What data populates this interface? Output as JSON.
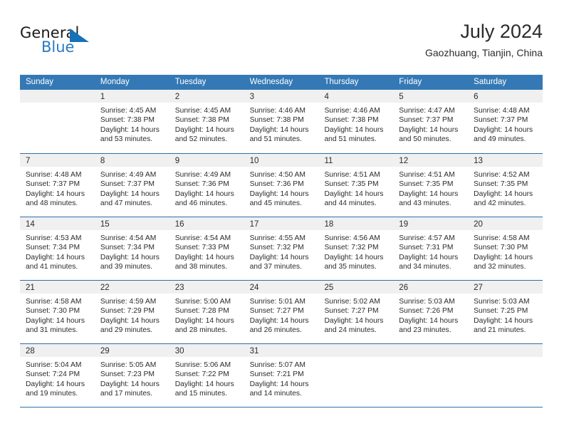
{
  "brand": {
    "word_one": "General",
    "word_two": "Blue",
    "logo_icon": "triangle-logo-icon",
    "accent_color": "#1572b8"
  },
  "header": {
    "title": "July 2024",
    "subtitle": "Gaozhuang, Tianjin, China"
  },
  "calendar": {
    "header_color": "#3479b5",
    "weekdays": [
      "Sunday",
      "Monday",
      "Tuesday",
      "Wednesday",
      "Thursday",
      "Friday",
      "Saturday"
    ],
    "weeks": [
      [
        {
          "day": "",
          "empty": true,
          "lines": []
        },
        {
          "day": "1",
          "lines": [
            "Sunrise: 4:45 AM",
            "Sunset: 7:38 PM",
            "Daylight: 14 hours",
            "and 53 minutes."
          ]
        },
        {
          "day": "2",
          "lines": [
            "Sunrise: 4:45 AM",
            "Sunset: 7:38 PM",
            "Daylight: 14 hours",
            "and 52 minutes."
          ]
        },
        {
          "day": "3",
          "lines": [
            "Sunrise: 4:46 AM",
            "Sunset: 7:38 PM",
            "Daylight: 14 hours",
            "and 51 minutes."
          ]
        },
        {
          "day": "4",
          "lines": [
            "Sunrise: 4:46 AM",
            "Sunset: 7:38 PM",
            "Daylight: 14 hours",
            "and 51 minutes."
          ]
        },
        {
          "day": "5",
          "lines": [
            "Sunrise: 4:47 AM",
            "Sunset: 7:37 PM",
            "Daylight: 14 hours",
            "and 50 minutes."
          ]
        },
        {
          "day": "6",
          "lines": [
            "Sunrise: 4:48 AM",
            "Sunset: 7:37 PM",
            "Daylight: 14 hours",
            "and 49 minutes."
          ]
        }
      ],
      [
        {
          "day": "7",
          "lines": [
            "Sunrise: 4:48 AM",
            "Sunset: 7:37 PM",
            "Daylight: 14 hours",
            "and 48 minutes."
          ]
        },
        {
          "day": "8",
          "lines": [
            "Sunrise: 4:49 AM",
            "Sunset: 7:37 PM",
            "Daylight: 14 hours",
            "and 47 minutes."
          ]
        },
        {
          "day": "9",
          "lines": [
            "Sunrise: 4:49 AM",
            "Sunset: 7:36 PM",
            "Daylight: 14 hours",
            "and 46 minutes."
          ]
        },
        {
          "day": "10",
          "lines": [
            "Sunrise: 4:50 AM",
            "Sunset: 7:36 PM",
            "Daylight: 14 hours",
            "and 45 minutes."
          ]
        },
        {
          "day": "11",
          "lines": [
            "Sunrise: 4:51 AM",
            "Sunset: 7:35 PM",
            "Daylight: 14 hours",
            "and 44 minutes."
          ]
        },
        {
          "day": "12",
          "lines": [
            "Sunrise: 4:51 AM",
            "Sunset: 7:35 PM",
            "Daylight: 14 hours",
            "and 43 minutes."
          ]
        },
        {
          "day": "13",
          "lines": [
            "Sunrise: 4:52 AM",
            "Sunset: 7:35 PM",
            "Daylight: 14 hours",
            "and 42 minutes."
          ]
        }
      ],
      [
        {
          "day": "14",
          "lines": [
            "Sunrise: 4:53 AM",
            "Sunset: 7:34 PM",
            "Daylight: 14 hours",
            "and 41 minutes."
          ]
        },
        {
          "day": "15",
          "lines": [
            "Sunrise: 4:54 AM",
            "Sunset: 7:34 PM",
            "Daylight: 14 hours",
            "and 39 minutes."
          ]
        },
        {
          "day": "16",
          "lines": [
            "Sunrise: 4:54 AM",
            "Sunset: 7:33 PM",
            "Daylight: 14 hours",
            "and 38 minutes."
          ]
        },
        {
          "day": "17",
          "lines": [
            "Sunrise: 4:55 AM",
            "Sunset: 7:32 PM",
            "Daylight: 14 hours",
            "and 37 minutes."
          ]
        },
        {
          "day": "18",
          "lines": [
            "Sunrise: 4:56 AM",
            "Sunset: 7:32 PM",
            "Daylight: 14 hours",
            "and 35 minutes."
          ]
        },
        {
          "day": "19",
          "lines": [
            "Sunrise: 4:57 AM",
            "Sunset: 7:31 PM",
            "Daylight: 14 hours",
            "and 34 minutes."
          ]
        },
        {
          "day": "20",
          "lines": [
            "Sunrise: 4:58 AM",
            "Sunset: 7:30 PM",
            "Daylight: 14 hours",
            "and 32 minutes."
          ]
        }
      ],
      [
        {
          "day": "21",
          "lines": [
            "Sunrise: 4:58 AM",
            "Sunset: 7:30 PM",
            "Daylight: 14 hours",
            "and 31 minutes."
          ]
        },
        {
          "day": "22",
          "lines": [
            "Sunrise: 4:59 AM",
            "Sunset: 7:29 PM",
            "Daylight: 14 hours",
            "and 29 minutes."
          ]
        },
        {
          "day": "23",
          "lines": [
            "Sunrise: 5:00 AM",
            "Sunset: 7:28 PM",
            "Daylight: 14 hours",
            "and 28 minutes."
          ]
        },
        {
          "day": "24",
          "lines": [
            "Sunrise: 5:01 AM",
            "Sunset: 7:27 PM",
            "Daylight: 14 hours",
            "and 26 minutes."
          ]
        },
        {
          "day": "25",
          "lines": [
            "Sunrise: 5:02 AM",
            "Sunset: 7:27 PM",
            "Daylight: 14 hours",
            "and 24 minutes."
          ]
        },
        {
          "day": "26",
          "lines": [
            "Sunrise: 5:03 AM",
            "Sunset: 7:26 PM",
            "Daylight: 14 hours",
            "and 23 minutes."
          ]
        },
        {
          "day": "27",
          "lines": [
            "Sunrise: 5:03 AM",
            "Sunset: 7:25 PM",
            "Daylight: 14 hours",
            "and 21 minutes."
          ]
        }
      ],
      [
        {
          "day": "28",
          "lines": [
            "Sunrise: 5:04 AM",
            "Sunset: 7:24 PM",
            "Daylight: 14 hours",
            "and 19 minutes."
          ]
        },
        {
          "day": "29",
          "lines": [
            "Sunrise: 5:05 AM",
            "Sunset: 7:23 PM",
            "Daylight: 14 hours",
            "and 17 minutes."
          ]
        },
        {
          "day": "30",
          "lines": [
            "Sunrise: 5:06 AM",
            "Sunset: 7:22 PM",
            "Daylight: 14 hours",
            "and 15 minutes."
          ]
        },
        {
          "day": "31",
          "lines": [
            "Sunrise: 5:07 AM",
            "Sunset: 7:21 PM",
            "Daylight: 14 hours",
            "and 14 minutes."
          ]
        },
        {
          "day": "",
          "empty": true,
          "lines": []
        },
        {
          "day": "",
          "empty": true,
          "lines": []
        },
        {
          "day": "",
          "empty": true,
          "lines": []
        }
      ]
    ]
  }
}
